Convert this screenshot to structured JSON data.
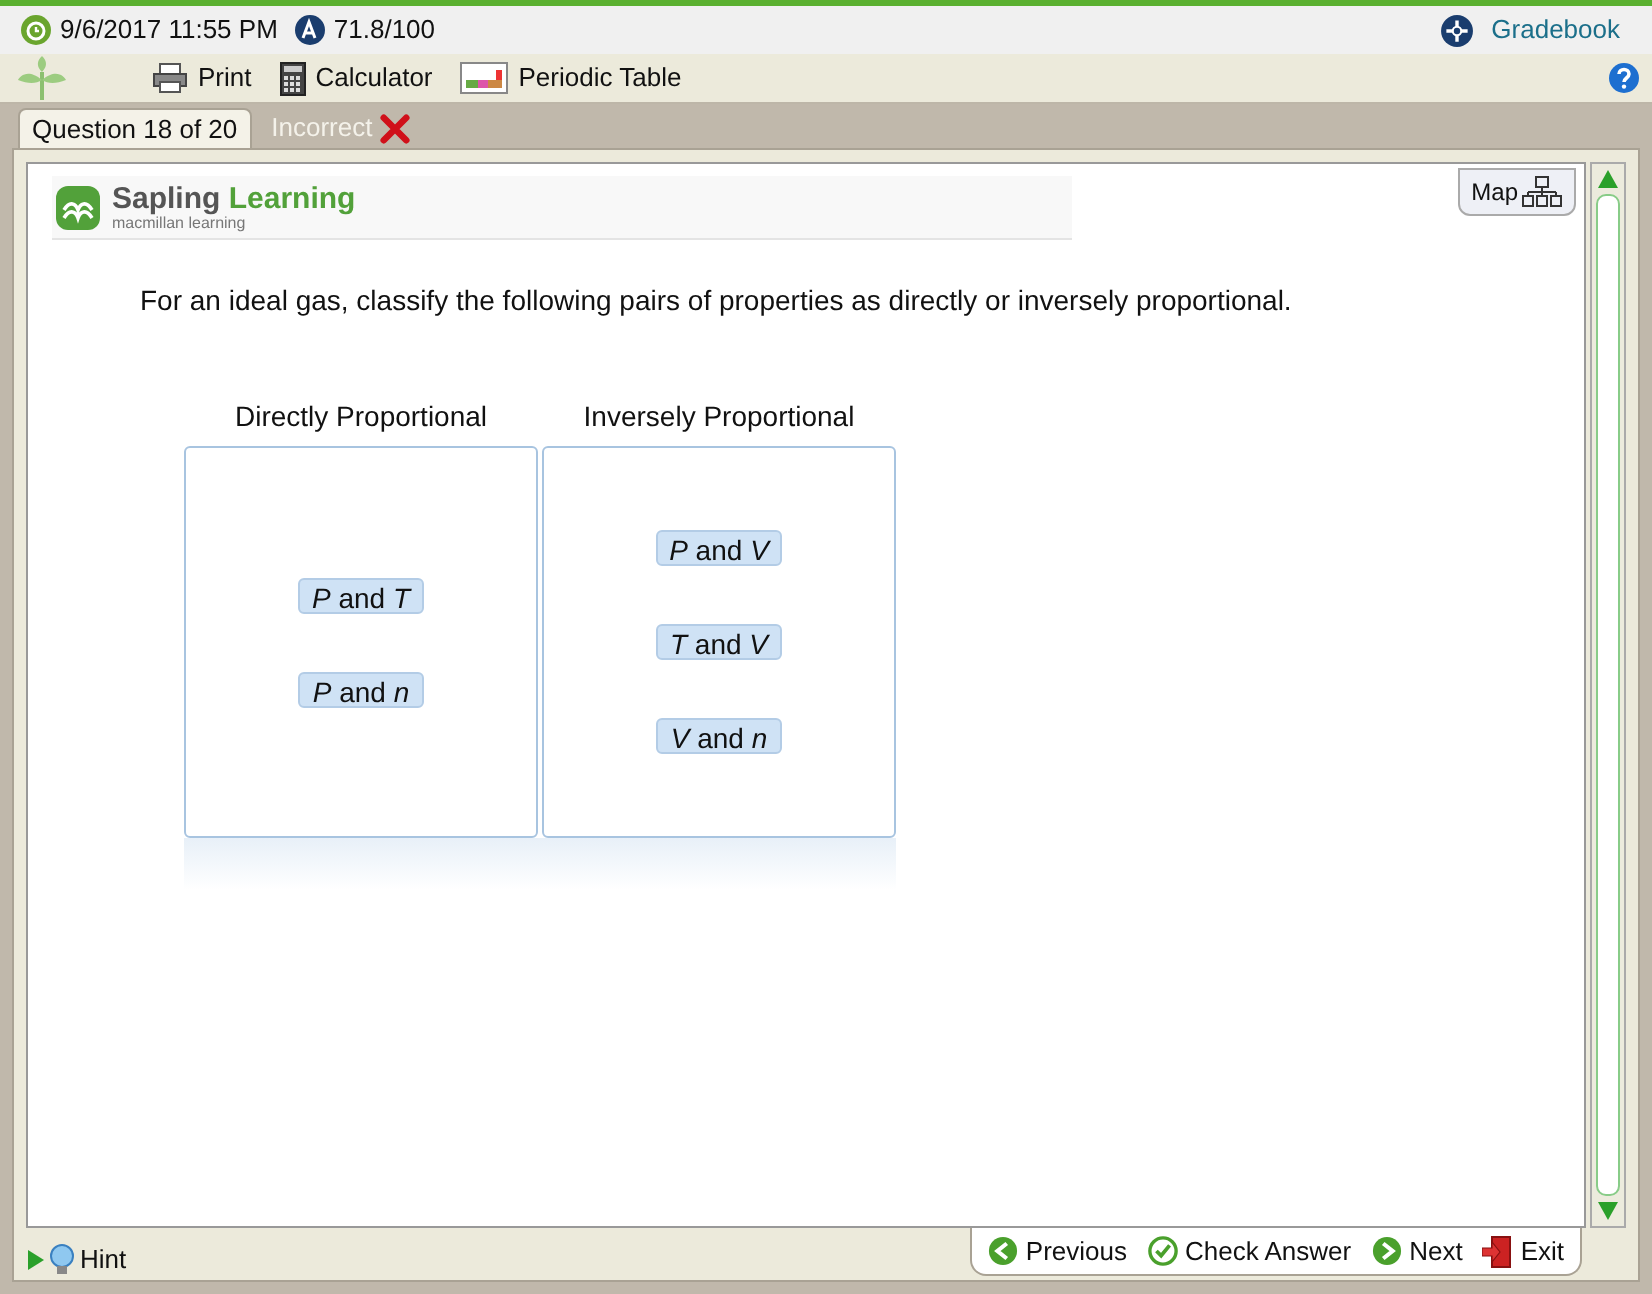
{
  "header": {
    "due": "9/6/2017 11:55 PM",
    "score": "71.8/100",
    "gradebook": "Gradebook"
  },
  "toolbar": [
    {
      "kind": "print",
      "label": "Print"
    },
    {
      "kind": "calculator",
      "label": "Calculator"
    },
    {
      "kind": "periodic",
      "label": "Periodic Table"
    }
  ],
  "tabs": [
    {
      "label": "Question 18 of 20",
      "selected": true,
      "incorrect": false
    },
    {
      "label": "Incorrect",
      "selected": false,
      "incorrect": true
    }
  ],
  "logo": {
    "name": "Sapling",
    "accent": "Learning",
    "sub": "macmillan learning"
  },
  "map": "Map",
  "question": "For an ideal gas, classify the following pairs of properties as directly or inversely proportional.",
  "bins": [
    {
      "title": "Directly Proportional",
      "items": [
        "*P* and *T*",
        "*P* and *n*"
      ]
    },
    {
      "title": "Inversely Proportional",
      "items": [
        "*P* and *V*",
        "*T* and *V*",
        "*V* and *n*"
      ]
    }
  ],
  "hint": "Hint",
  "nav": [
    {
      "kind": "previous",
      "label": "Previous"
    },
    {
      "kind": "check",
      "label": "Check Answer"
    },
    {
      "kind": "next",
      "label": "Next"
    },
    {
      "kind": "exit",
      "label": "Exit"
    }
  ]
}
